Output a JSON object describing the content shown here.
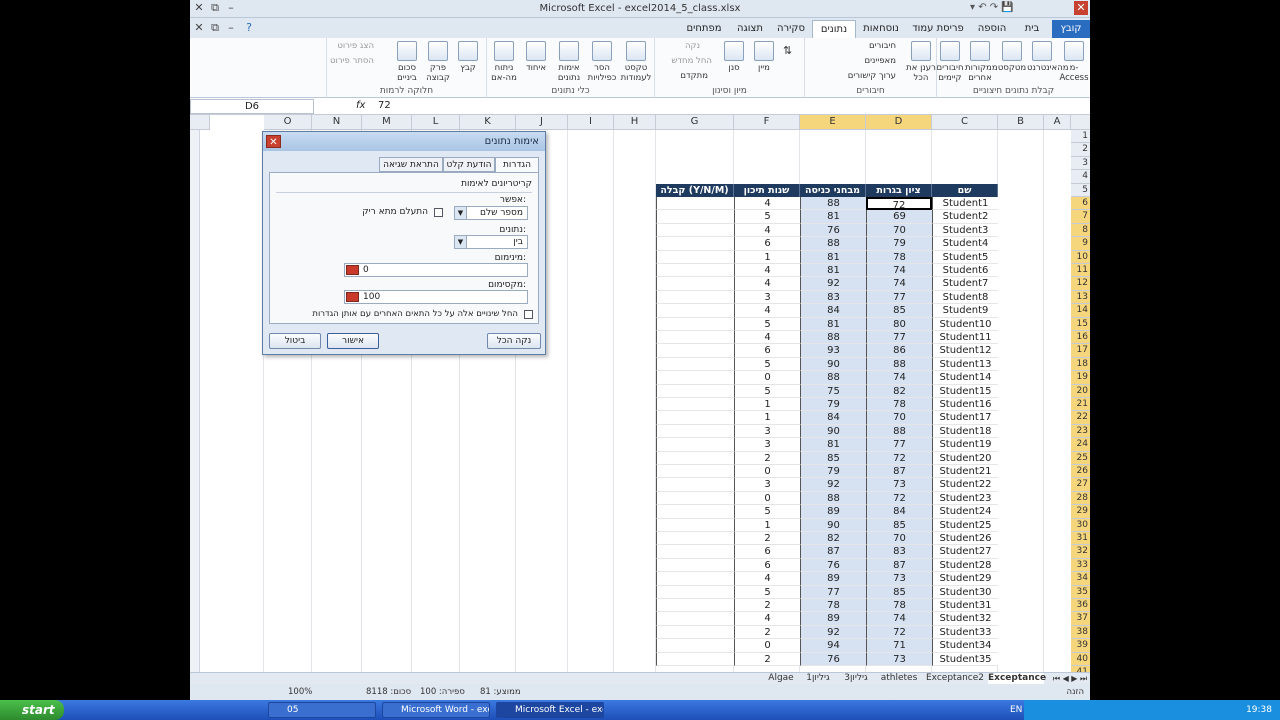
{
  "window": {
    "title": "Microsoft Excel  -  excel2014_5_class.xlsx"
  },
  "tabs": [
    "קובץ",
    "בית",
    "הוספה",
    "פריסת עמוד",
    "נוסחאות",
    "נתונים",
    "סקירה",
    "תצוגה",
    "מפתחים"
  ],
  "ribbon": {
    "groups": [
      "קבלת נתונים חיצוניים",
      "חיבורים",
      "מיון וסינון",
      "כלי נתונים",
      "חלוקה לרמות"
    ],
    "buttons": {
      "access": "מ- Access",
      "web": "מהאינטרנט",
      "text": "מטקסט",
      "other": "ממקורות אחרים",
      "existing": "חיבורים קיימים",
      "refresh": "רענן את הכל",
      "connections": "חיבורים",
      "properties": "מאפיינים",
      "edit_links": "ערוך קישורים",
      "sort": "מיין",
      "filter": "סנן",
      "clear": "נקה",
      "reapply": "החל מחדש",
      "advanced": "מתקדם",
      "text_to_cols": "טקסט לעמודות",
      "remove_dup": "הסר כפילויות",
      "validation": "אימות נתונים",
      "consolidate": "איחוד",
      "whatif": "ניתוח מה-אם",
      "group": "קבץ",
      "ungroup": "פרק קבוצה",
      "subtotal": "סכום ביניים",
      "show_detail": "הצג פירוט",
      "hide_detail": "הסתר פירוט"
    }
  },
  "formula_bar": {
    "name_box": "D6",
    "fx": "fx",
    "value": "72"
  },
  "columns": [
    "A",
    "B",
    "C",
    "D",
    "E",
    "F",
    "G",
    "H",
    "I",
    "J",
    "K",
    "L",
    "M",
    "N",
    "O"
  ],
  "table": {
    "headers": {
      "c": "שם",
      "d": "ציון בגרות",
      "e": "מבחני כניסה",
      "f": "שנות תיכון",
      "g": "קבלה (Y/N/M)"
    },
    "rows": [
      [
        "Student1",
        "72",
        "88",
        "4"
      ],
      [
        "Student2",
        "69",
        "81",
        "5"
      ],
      [
        "Student3",
        "70",
        "76",
        "4"
      ],
      [
        "Student4",
        "79",
        "88",
        "6"
      ],
      [
        "Student5",
        "78",
        "81",
        "1"
      ],
      [
        "Student6",
        "74",
        "81",
        "4"
      ],
      [
        "Student7",
        "74",
        "92",
        "4"
      ],
      [
        "Student8",
        "77",
        "83",
        "3"
      ],
      [
        "Student9",
        "85",
        "84",
        "4"
      ],
      [
        "Student10",
        "80",
        "81",
        "5"
      ],
      [
        "Student11",
        "77",
        "88",
        "4"
      ],
      [
        "Student12",
        "86",
        "93",
        "6"
      ],
      [
        "Student13",
        "88",
        "90",
        "5"
      ],
      [
        "Student14",
        "74",
        "88",
        "0"
      ],
      [
        "Student15",
        "82",
        "75",
        "5"
      ],
      [
        "Student16",
        "78",
        "79",
        "1"
      ],
      [
        "Student17",
        "70",
        "84",
        "1"
      ],
      [
        "Student18",
        "88",
        "90",
        "3"
      ],
      [
        "Student19",
        "77",
        "81",
        "3"
      ],
      [
        "Student20",
        "72",
        "85",
        "2"
      ],
      [
        "Student21",
        "87",
        "79",
        "0"
      ],
      [
        "Student22",
        "73",
        "92",
        "3"
      ],
      [
        "Student23",
        "72",
        "88",
        "0"
      ],
      [
        "Student24",
        "84",
        "89",
        "5"
      ],
      [
        "Student25",
        "85",
        "90",
        "1"
      ],
      [
        "Student26",
        "70",
        "82",
        "2"
      ],
      [
        "Student27",
        "83",
        "87",
        "6"
      ],
      [
        "Student28",
        "87",
        "76",
        "6"
      ],
      [
        "Student29",
        "73",
        "89",
        "4"
      ],
      [
        "Student30",
        "85",
        "77",
        "5"
      ],
      [
        "Student31",
        "78",
        "78",
        "2"
      ],
      [
        "Student32",
        "74",
        "89",
        "4"
      ],
      [
        "Student33",
        "72",
        "92",
        "2"
      ],
      [
        "Student34",
        "71",
        "94",
        "0"
      ],
      [
        "Student35",
        "73",
        "76",
        "2"
      ]
    ]
  },
  "dialog": {
    "title": "אימות נתונים",
    "tabs": [
      "הגדרות",
      "הודעת קלט",
      "התראת שגיאה"
    ],
    "section": "קריטריונים לאימות",
    "allow_label": "אפשר:",
    "allow_value": "מספר שלם",
    "ignore_blank": "התעלם מתא ריק",
    "data_label": "נתונים:",
    "data_value": "בין",
    "min_label": "מינימום:",
    "min_value": "0",
    "max_label": "מקסימום:",
    "max_value": "100",
    "apply_all": "החל שינויים אלה על כל התאים האחרים עם אותן הגדרות",
    "clear_all": "נקה הכל",
    "ok": "אישור",
    "cancel": "ביטול"
  },
  "sheet_tabs": [
    "Exceptance",
    "Exceptance2",
    "athletes",
    "גיליון3",
    "גיליון1",
    "Algae"
  ],
  "status": {
    "ready": "הזנה",
    "average": "ממוצע: 81",
    "count": "ספירה: 100",
    "sum": "סכום: 8118",
    "zoom": "100%"
  },
  "taskbar": {
    "start": "start",
    "items": [
      "05",
      "Microsoft Word - exc...",
      "Microsoft Excel - exc..."
    ],
    "lang": "EN",
    "time": "19:38"
  }
}
